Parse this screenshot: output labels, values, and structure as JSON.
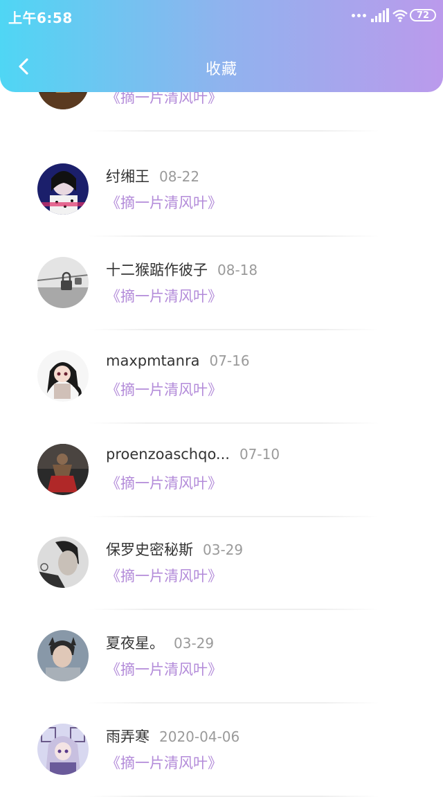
{
  "status_bar": {
    "time": "上午6:58",
    "battery": "72"
  },
  "header": {
    "title": "收藏",
    "back_icon": "chevron-left-icon"
  },
  "items": [
    {
      "name": "",
      "date": "",
      "work": "《摘一片清风叶》",
      "avatar_colors": [
        "#3a2a18",
        "#b08040"
      ]
    },
    {
      "name": "纣缃王",
      "date": "08-22",
      "work": "《摘一片清风叶》",
      "avatar_colors": [
        "#1b1f6b",
        "#e8d8e0"
      ]
    },
    {
      "name": "十二猴踮作彼子",
      "date": "08-18",
      "work": "《摘一片清风叶》",
      "avatar_colors": [
        "#dcdcdc",
        "#555555"
      ]
    },
    {
      "name": "maxpmtanra",
      "date": "07-16",
      "work": "《摘一片清风叶》",
      "avatar_colors": [
        "#f4f4f4",
        "#2a2a2a"
      ]
    },
    {
      "name": "proenzoaschqo...",
      "date": "07-10",
      "work": "《摘一片清风叶》",
      "avatar_colors": [
        "#2a2a2a",
        "#b02828"
      ]
    },
    {
      "name": "保罗史密秘斯",
      "date": "03-29",
      "work": "《摘一片清风叶》",
      "avatar_colors": [
        "#303030",
        "#c8c8c8"
      ]
    },
    {
      "name": "夏夜星。",
      "date": "03-29",
      "work": "《摘一片清风叶》",
      "avatar_colors": [
        "#3a4a5a",
        "#d8c0b0"
      ]
    },
    {
      "name": "雨弄寒",
      "date": "2020-04-06",
      "work": "《摘一片清风叶》",
      "avatar_colors": [
        "#c8c8e8",
        "#4a3a6a"
      ]
    }
  ]
}
